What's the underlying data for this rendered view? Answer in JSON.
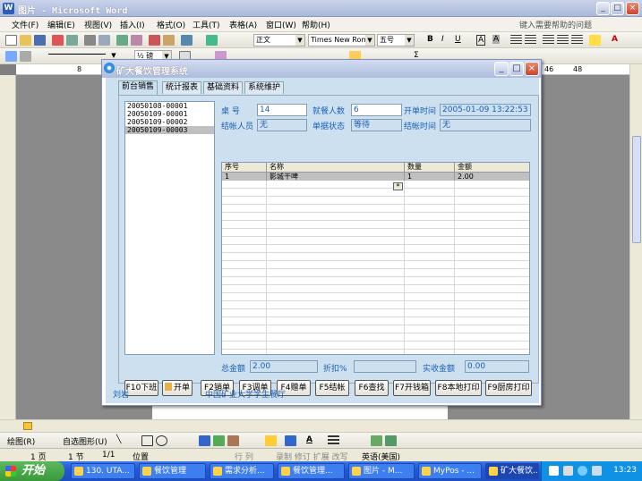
{
  "word": {
    "title": "图片 - Microsoft Word",
    "menus": [
      "文件(F)",
      "编辑(E)",
      "视图(V)",
      "插入(I)",
      "格式(O)",
      "工具(T)",
      "表格(A)",
      "窗口(W)",
      "帮助(H)"
    ],
    "help_placeholder": "键入需要帮助的问题",
    "style_combo": "正文",
    "font_combo": "Times New Roman",
    "size_combo": "五号",
    "zoom_combo": "½ 磅",
    "ruler_left": "8",
    "ruler_right": [
      "46",
      "48"
    ],
    "draw_label": "绘图(R)",
    "autoshape_label": "自选图形(U)",
    "status": {
      "page": "1 页",
      "section": "1 节",
      "pages": "1/1",
      "position": "位置",
      "row_col": "行  列",
      "rec": "录制  修订  扩展  改写",
      "lang": "英语(美国)"
    }
  },
  "taskbar": {
    "start": "开始",
    "tasks": [
      "130. UTA...",
      "餐饮管理",
      "需求分析...",
      "餐饮管理...",
      "图片 - M...",
      "MyPos - ...",
      "矿大餐饮..."
    ],
    "clock": "13:23"
  },
  "dialog": {
    "title": "矿大餐饮管理系统",
    "tabs": [
      "前台销售",
      "统计报表",
      "基础资料",
      "系统维护"
    ],
    "orders": [
      "20050108-00001",
      "20050109-00001",
      "20050109-00002",
      "20050109-00003"
    ],
    "fields": {
      "table_label": "桌    号",
      "table_value": "14",
      "diners_label": "就餐人数",
      "diners_value": "6",
      "open_time_label": "开单时间",
      "open_time_value": "2005-01-09 13:22:53",
      "cashier_label": "结帐人员",
      "cashier_value": "无",
      "state_label": "单据状态",
      "state_value": "等待",
      "checkout_time_label": "结帐时间",
      "checkout_time_value": "无"
    },
    "grid": {
      "headers": [
        "序号",
        "名称",
        "数量",
        "金额"
      ],
      "rows": [
        [
          "1",
          "影城干啤",
          "1",
          "2.00"
        ]
      ],
      "new_row_marker": "*"
    },
    "totals": {
      "total_label": "总金额",
      "total_value": "2.00",
      "discount_label": "折扣%",
      "discount_value": "",
      "receivable_label": "实收金额",
      "receivable_value": "0.00"
    },
    "buttons": [
      "F10下班",
      "开单",
      "F2销单",
      "F3调单",
      "F4赠单",
      "F5结帐",
      "F6查找",
      "F7开钱箱",
      "F8本地打印",
      "F9厨房打印"
    ],
    "footer_user": "刘岩",
    "footer_org": "中国矿业大学学生餐厅"
  }
}
